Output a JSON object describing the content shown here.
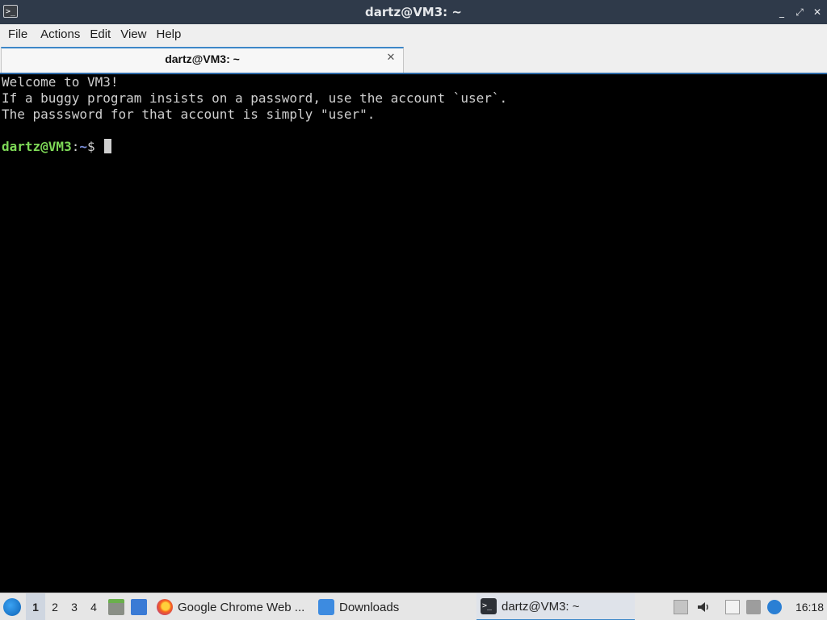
{
  "window": {
    "title": "dartz@VM3: ~",
    "controls": {
      "minimize": "_",
      "restore": "⤢",
      "close": "✕"
    }
  },
  "menubar": {
    "items": [
      "File",
      "Actions",
      "Edit",
      "View",
      "Help"
    ]
  },
  "tabs": [
    {
      "label": "dartz@VM3: ~",
      "active": true
    }
  ],
  "terminal": {
    "lines": [
      "Welcome to VM3!",
      "If a buggy program insists on a password, use the account `user`.",
      "The passsword for that account is simply \"user\"."
    ],
    "prompt": {
      "user_host": "dartz@VM3",
      "separator": ":",
      "path": "~",
      "symbol": "$"
    },
    "colors": {
      "user_host": "#7ed957",
      "path": "#7b8ed9",
      "text": "#cfcfcf",
      "background": "#000000"
    }
  },
  "taskbar": {
    "workspaces": [
      "1",
      "2",
      "3",
      "4"
    ],
    "active_workspace": "1",
    "tasks": [
      {
        "label": "Google Chrome Web ...",
        "icon": "firefox-icon"
      },
      {
        "label": "Downloads",
        "icon": "folder-icon"
      },
      {
        "label": "dartz@VM3: ~",
        "icon": "terminal-icon",
        "active": true
      }
    ],
    "clock": "16:18"
  }
}
